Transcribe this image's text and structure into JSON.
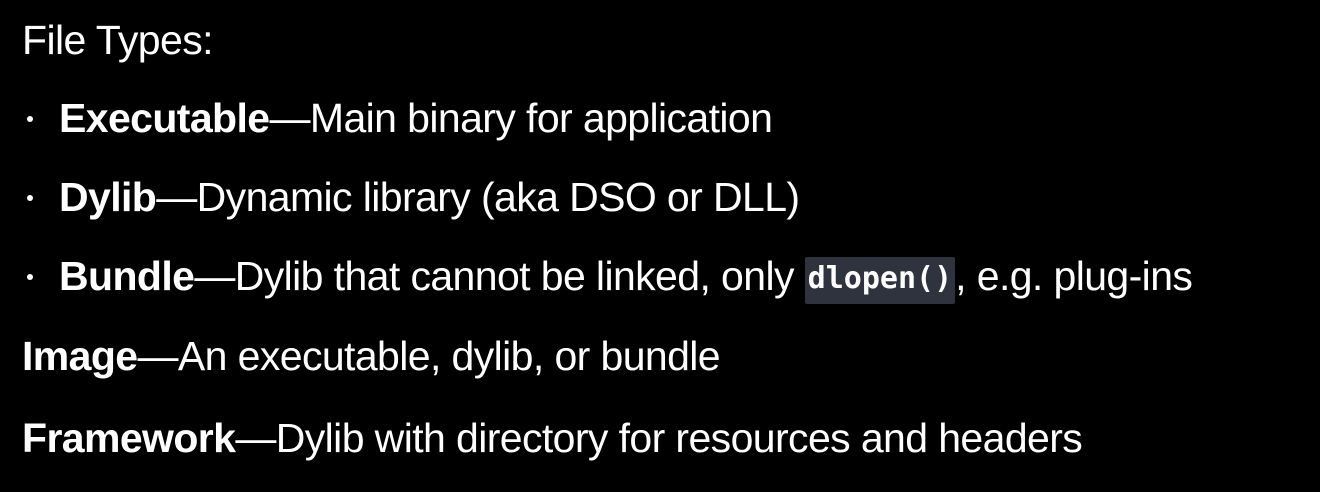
{
  "heading": "File Types:",
  "bullets": [
    {
      "term": "Executable",
      "separator": "—",
      "description": "Main binary for application"
    },
    {
      "term": "Dylib",
      "separator": "—",
      "description": "Dynamic library (aka DSO or DLL)"
    },
    {
      "term": "Bundle",
      "separator": "—",
      "description_before": "Dylib that cannot be linked, only ",
      "code": "dlopen()",
      "description_after": ", e.g. plug-ins"
    }
  ],
  "definitions": [
    {
      "term": "Image",
      "separator": "—",
      "description": "An executable, dylib, or bundle"
    },
    {
      "term": "Framework",
      "separator": "—",
      "description": "Dylib with directory for resources and headers"
    }
  ],
  "colors": {
    "background": "#000000",
    "text": "#ffffff",
    "code_background": "#2f333d"
  }
}
